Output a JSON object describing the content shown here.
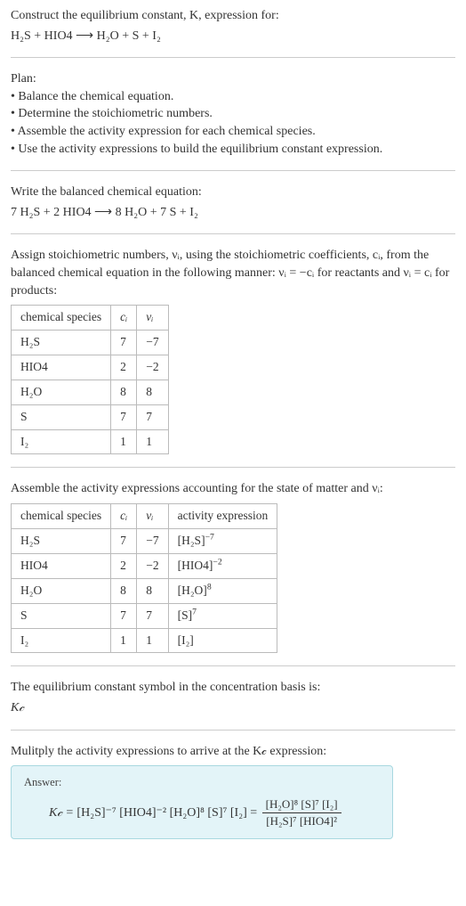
{
  "intro": {
    "line1": "Construct the equilibrium constant, K, expression for:",
    "eq": "H₂S + HIO4 ⟶ H₂O + S + I₂"
  },
  "plan": {
    "heading": "Plan:",
    "b1": "• Balance the chemical equation.",
    "b2": "• Determine the stoichiometric numbers.",
    "b3": "• Assemble the activity expression for each chemical species.",
    "b4": "• Use the activity expressions to build the equilibrium constant expression."
  },
  "balanced": {
    "heading": "Write the balanced chemical equation:",
    "eq": "7 H₂S + 2 HIO4 ⟶ 8 H₂O + 7 S + I₂"
  },
  "stoich": {
    "text_a": "Assign stoichiometric numbers, νᵢ, using the stoichiometric coefficients, cᵢ, from the balanced chemical equation in the following manner: νᵢ = −cᵢ for reactants and νᵢ = cᵢ for products:",
    "headers": {
      "h1": "chemical species",
      "h2": "cᵢ",
      "h3": "νᵢ"
    },
    "rows": [
      {
        "sp": "H₂S",
        "c": "7",
        "v": "−7"
      },
      {
        "sp": "HIO4",
        "c": "2",
        "v": "−2"
      },
      {
        "sp": "H₂O",
        "c": "8",
        "v": "8"
      },
      {
        "sp": "S",
        "c": "7",
        "v": "7"
      },
      {
        "sp": "I₂",
        "c": "1",
        "v": "1"
      }
    ]
  },
  "activity": {
    "text": "Assemble the activity expressions accounting for the state of matter and νᵢ:",
    "headers": {
      "h1": "chemical species",
      "h2": "cᵢ",
      "h3": "νᵢ",
      "h4": "activity expression"
    },
    "rows": [
      {
        "sp": "H₂S",
        "c": "7",
        "v": "−7",
        "a_base": "[H₂S]",
        "a_exp": "−7"
      },
      {
        "sp": "HIO4",
        "c": "2",
        "v": "−2",
        "a_base": "[HIO4]",
        "a_exp": "−2"
      },
      {
        "sp": "H₂O",
        "c": "8",
        "v": "8",
        "a_base": "[H₂O]",
        "a_exp": "8"
      },
      {
        "sp": "S",
        "c": "7",
        "v": "7",
        "a_base": "[S]",
        "a_exp": "7"
      },
      {
        "sp": "I₂",
        "c": "1",
        "v": "1",
        "a_base": "[I₂]",
        "a_exp": ""
      }
    ]
  },
  "symbol": {
    "l1": "The equilibrium constant symbol in the concentration basis is:",
    "l2": "K𝒸"
  },
  "multiply": {
    "text": "Mulitply the activity expressions to arrive at the K𝒸 expression:"
  },
  "answer": {
    "label": "Answer:",
    "lhs": "K𝒸 = ",
    "prod_text": "[H₂S]⁻⁷ [HIO4]⁻² [H₂O]⁸ [S]⁷ [I₂] = ",
    "frac_num": "[H₂O]⁸ [S]⁷ [I₂]",
    "frac_den": "[H₂S]⁷ [HIO4]²"
  },
  "chart_data": {
    "type": "table",
    "tables": [
      {
        "title": "Stoichiometric numbers",
        "columns": [
          "chemical species",
          "c_i",
          "v_i"
        ],
        "rows": [
          [
            "H2S",
            7,
            -7
          ],
          [
            "HIO4",
            2,
            -2
          ],
          [
            "H2O",
            8,
            8
          ],
          [
            "S",
            7,
            7
          ],
          [
            "I2",
            1,
            1
          ]
        ]
      },
      {
        "title": "Activity expressions",
        "columns": [
          "chemical species",
          "c_i",
          "v_i",
          "activity expression"
        ],
        "rows": [
          [
            "H2S",
            7,
            -7,
            "[H2S]^-7"
          ],
          [
            "HIO4",
            2,
            -2,
            "[HIO4]^-2"
          ],
          [
            "H2O",
            8,
            8,
            "[H2O]^8"
          ],
          [
            "S",
            7,
            7,
            "[S]^7"
          ],
          [
            "I2",
            1,
            1,
            "[I2]"
          ]
        ]
      }
    ]
  }
}
